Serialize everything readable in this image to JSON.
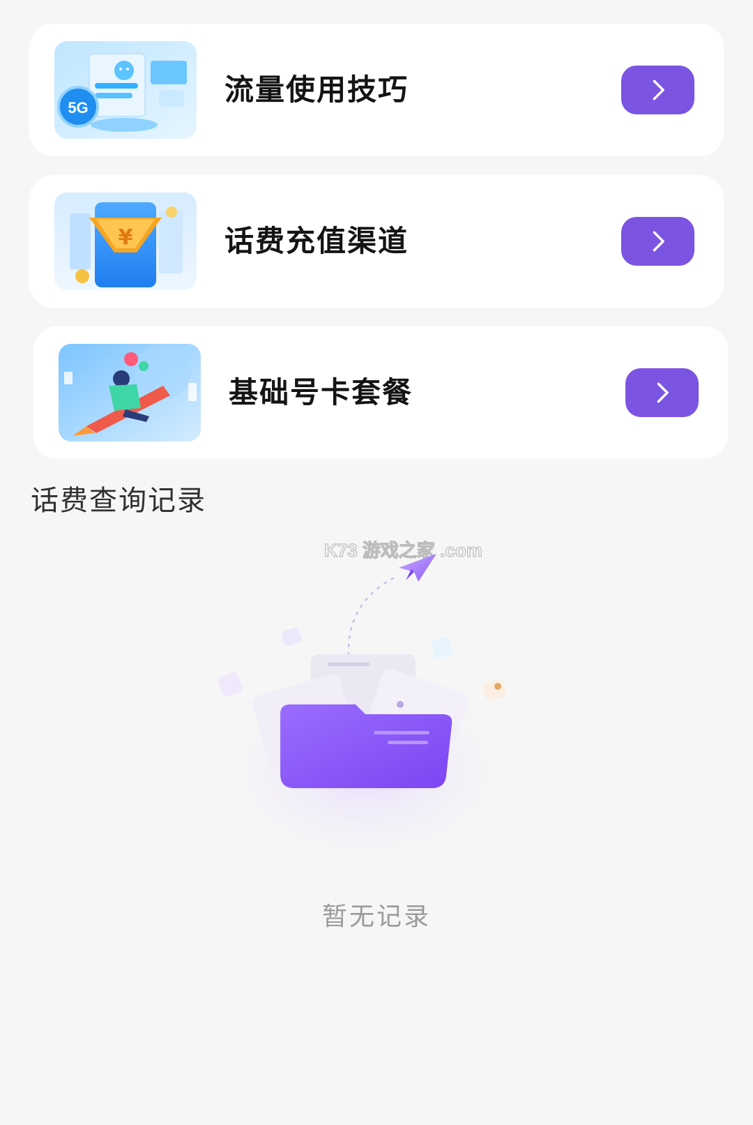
{
  "cards": [
    {
      "title": "流量使用技巧",
      "thumb_icon": "5g-data-illustration",
      "badge": "5G"
    },
    {
      "title": "话费充值渠道",
      "thumb_icon": "phone-recharge-yuan-illustration",
      "badge": "¥"
    },
    {
      "title": "基础号卡套餐",
      "thumb_icon": "rocket-rider-illustration"
    }
  ],
  "history": {
    "title": "话费查询记录",
    "empty_text": "暂无记录",
    "empty_icon": "empty-folder-icon",
    "watermark": "K73 游戏之家 .com"
  },
  "colors": {
    "accent": "#7b54e2",
    "background": "#f6f6f6",
    "card": "#ffffff"
  }
}
